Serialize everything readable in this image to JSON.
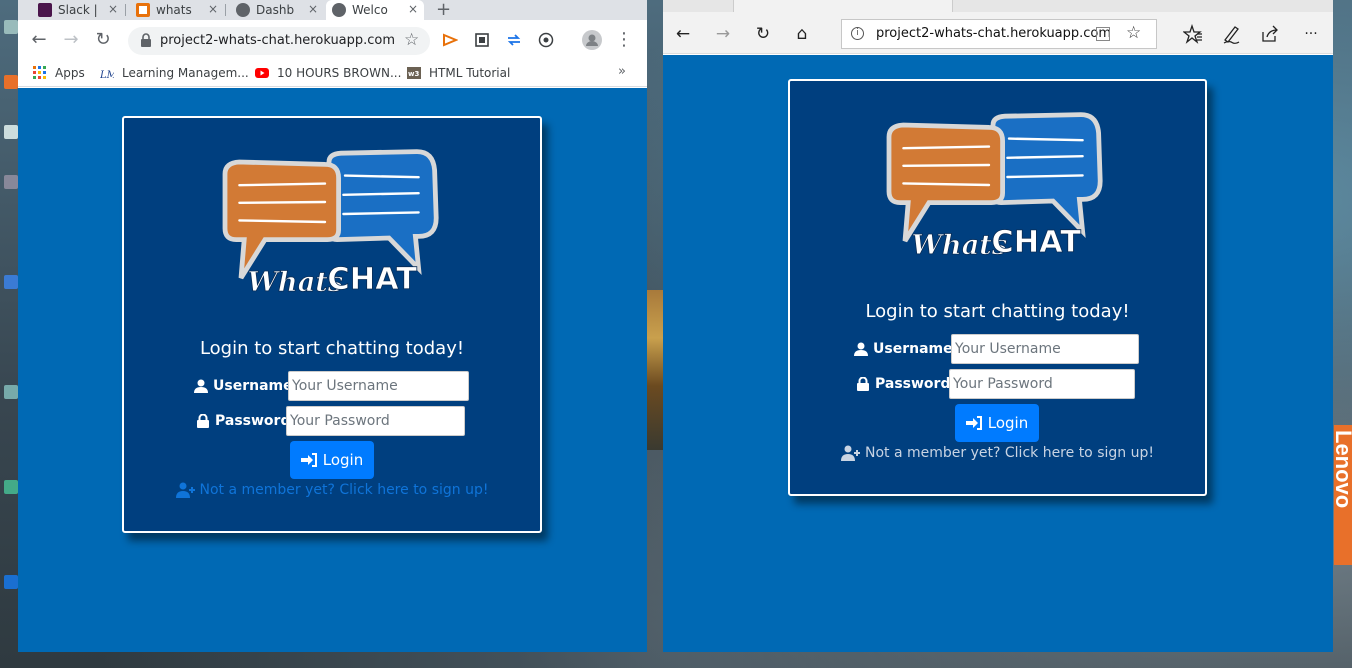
{
  "chrome": {
    "tabs": [
      {
        "label": "Slack |",
        "favicon_color": "#4a154b"
      },
      {
        "label": "whats",
        "favicon_color": "#e8710a"
      },
      {
        "label": "Dashb",
        "favicon_color": "#5f6368"
      },
      {
        "label": "Welco",
        "favicon_color": "#5f6368"
      }
    ],
    "tab_close": "×",
    "new_tab": "+",
    "back": "←",
    "forward": "→",
    "reload": "↻",
    "url": "project2-whats-chat.herokuapp.com",
    "star": "☆",
    "menu": "⋮",
    "bookmarks": [
      {
        "label": "Apps",
        "icon": "apps-grid-icon"
      },
      {
        "label": "Learning Managem...",
        "icon": "lms-icon"
      },
      {
        "label": "10 HOURS BROWN...",
        "icon": "youtube-icon"
      },
      {
        "label": "HTML Tutorial",
        "icon": "w3schools-icon"
      }
    ],
    "bookmarks_more": "»"
  },
  "edge": {
    "url": "project2-whats-chat.herokuapp.com",
    "back": "←",
    "forward": "→",
    "refresh": "↻",
    "home": "⌂",
    "star": "☆",
    "favorites": "☆",
    "more": "···"
  },
  "login": {
    "brand_first": "Whats",
    "brand_second": "CHAT",
    "title": "Login to start chatting today!",
    "username_label": "Username:",
    "username_placeholder": "Your Username",
    "password_label": "Password:",
    "password_placeholder": "Your Password",
    "login_button": "Login",
    "signup_text": "Not a member yet? Click here to sign up!"
  },
  "colors": {
    "page_bg": "#0069b4",
    "card_bg": "#003f7f",
    "button": "#007bff",
    "bubble_orange": "#d27a35",
    "bubble_blue": "#1565b7",
    "signup_chrome": "#0f74d9",
    "signup_edge": "#c9d4e3"
  },
  "desktop": {
    "brand": "Lenovo"
  }
}
